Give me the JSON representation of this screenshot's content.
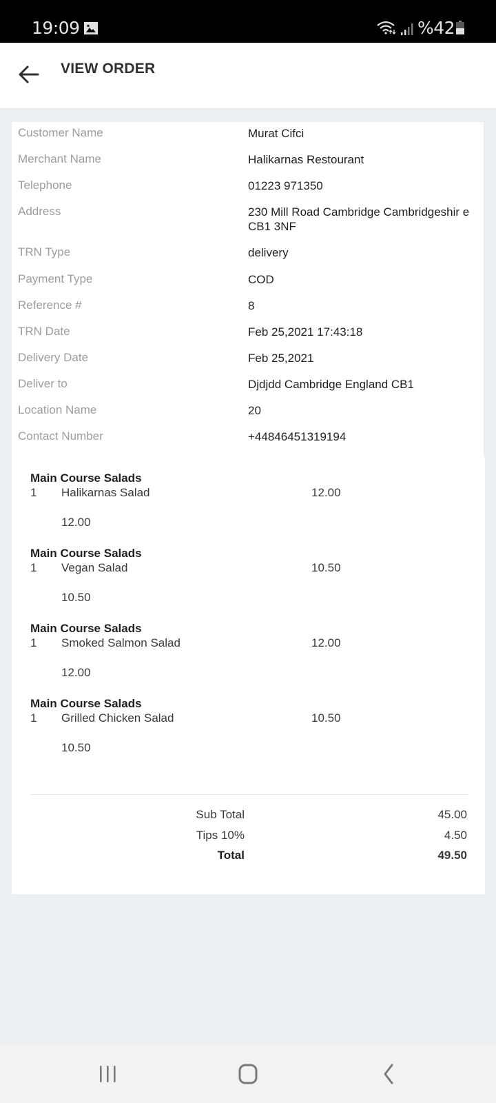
{
  "status_bar": {
    "time": "19:09",
    "battery": "%42",
    "icons": [
      "image-icon",
      "wifi-icon",
      "signal-icon",
      "battery-icon"
    ]
  },
  "app_bar": {
    "title": "VIEW ORDER",
    "back_icon": "arrow-left-icon"
  },
  "order_info": [
    {
      "label": "Customer Name",
      "value": "Murat Cifci"
    },
    {
      "label": "Merchant Name",
      "value": "Halikarnas Restourant"
    },
    {
      "label": "Telephone",
      "value": "01223 971350"
    },
    {
      "label": "Address",
      "value": "230 Mill Road Cambridge Cambridgeshir e CB1 3NF"
    },
    {
      "label": "TRN Type",
      "value": "delivery"
    },
    {
      "label": "Payment Type",
      "value": "COD"
    },
    {
      "label": "Reference #",
      "value": "8"
    },
    {
      "label": "TRN Date",
      "value": "Feb 25,2021 17:43:18"
    },
    {
      "label": "Delivery Date",
      "value": "Feb 25,2021"
    },
    {
      "label": "Deliver to",
      "value": "Djdjdd Cambridge England CB1"
    },
    {
      "label": "Location Name",
      "value": "20"
    },
    {
      "label": "Contact Number",
      "value": "+44846451319194"
    }
  ],
  "items": [
    {
      "category": "Main Course Salads",
      "qty": "1",
      "name": "Halikarnas Salad",
      "price": "12.00",
      "line_total": "12.00"
    },
    {
      "category": "Main Course Salads",
      "qty": "1",
      "name": "Vegan Salad",
      "price": "10.50",
      "line_total": "10.50"
    },
    {
      "category": "Main Course Salads",
      "qty": "1",
      "name": "Smoked Salmon Salad",
      "price": "12.00",
      "line_total": "12.00"
    },
    {
      "category": "Main Course Salads",
      "qty": "1",
      "name": "Grilled Chicken Salad",
      "price": "10.50",
      "line_total": "10.50"
    }
  ],
  "totals": {
    "sub_total_label": "Sub Total",
    "sub_total": "45.00",
    "tips_label": "Tips 10%",
    "tips": "4.50",
    "total_label": "Total",
    "total": "49.50"
  },
  "nav_bar": {
    "buttons": [
      "recent-apps",
      "home",
      "back"
    ]
  }
}
